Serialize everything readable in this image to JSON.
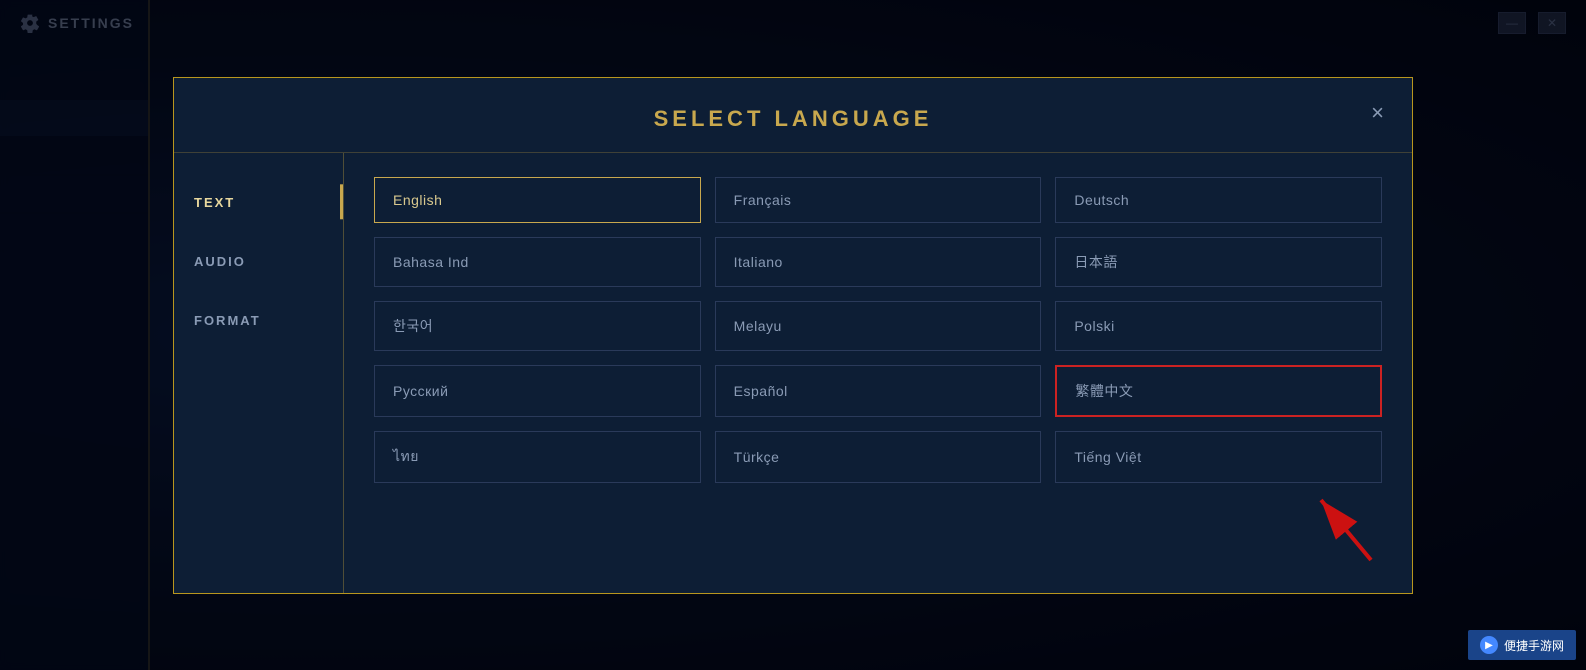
{
  "app": {
    "title": "SETTINGS"
  },
  "topbar": {
    "icon1": "minimize-icon",
    "icon2": "close-window-icon"
  },
  "sidebar": {
    "items": [
      {
        "id": "sidebar-item-1",
        "label": ""
      },
      {
        "id": "sidebar-item-2",
        "label": ""
      },
      {
        "id": "sidebar-item-3",
        "label": ""
      },
      {
        "id": "sidebar-item-4",
        "label": ""
      }
    ]
  },
  "dialog": {
    "title": "SELECT LANGUAGE",
    "close_label": "×",
    "tabs": [
      {
        "id": "tab-text",
        "label": "TEXT",
        "active": true
      },
      {
        "id": "tab-audio",
        "label": "AUDIO",
        "active": false
      },
      {
        "id": "tab-format",
        "label": "FORMAT",
        "active": false
      }
    ],
    "languages": [
      {
        "id": "lang-english",
        "label": "English",
        "state": "selected-gold",
        "row": 1,
        "col": 1
      },
      {
        "id": "lang-francais",
        "label": "Français",
        "state": "normal",
        "row": 1,
        "col": 2
      },
      {
        "id": "lang-deutsch",
        "label": "Deutsch",
        "state": "normal",
        "row": 1,
        "col": 3
      },
      {
        "id": "lang-bahasa",
        "label": "Bahasa Ind",
        "state": "normal",
        "row": 2,
        "col": 1
      },
      {
        "id": "lang-italiano",
        "label": "Italiano",
        "state": "normal",
        "row": 2,
        "col": 2
      },
      {
        "id": "lang-japanese",
        "label": "日本語",
        "state": "normal",
        "row": 2,
        "col": 3
      },
      {
        "id": "lang-korean",
        "label": "한국어",
        "state": "normal",
        "row": 3,
        "col": 1
      },
      {
        "id": "lang-melayu",
        "label": "Melayu",
        "state": "normal",
        "row": 3,
        "col": 2
      },
      {
        "id": "lang-polski",
        "label": "Polski",
        "state": "normal",
        "row": 3,
        "col": 3
      },
      {
        "id": "lang-russian",
        "label": "Русский",
        "state": "normal",
        "row": 4,
        "col": 1
      },
      {
        "id": "lang-espanol",
        "label": "Español",
        "state": "normal",
        "row": 4,
        "col": 2
      },
      {
        "id": "lang-chinese-traditional",
        "label": "繁體中文",
        "state": "selected-red",
        "row": 4,
        "col": 3
      },
      {
        "id": "lang-thai",
        "label": "ไทย",
        "state": "normal",
        "row": 5,
        "col": 1
      },
      {
        "id": "lang-turkish",
        "label": "Türkçe",
        "state": "normal",
        "row": 5,
        "col": 2
      },
      {
        "id": "lang-vietnamese",
        "label": "Tiếng Việt",
        "state": "normal",
        "row": 5,
        "col": 3
      }
    ]
  },
  "watermark": {
    "icon": "▶",
    "text": "便捷手游网"
  }
}
